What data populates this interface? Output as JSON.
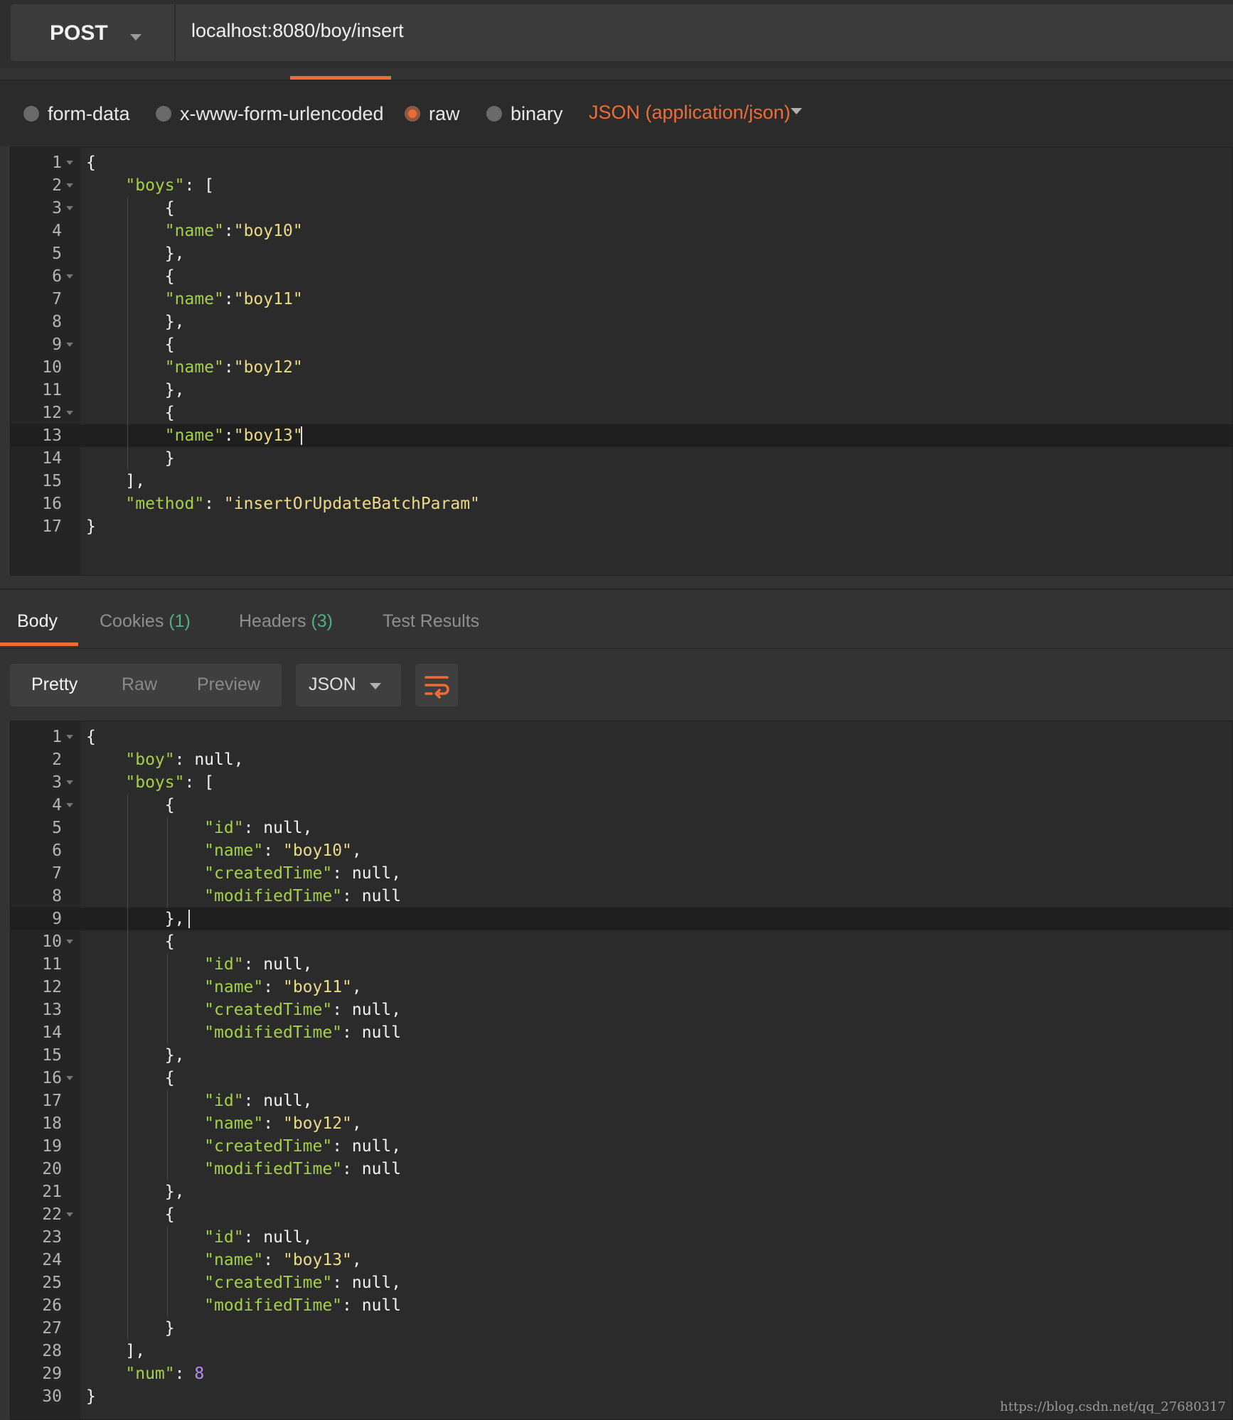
{
  "request": {
    "method": "POST",
    "url": "localhost:8080/boy/insert"
  },
  "body_type": {
    "options": [
      "form-data",
      "x-www-form-urlencoded",
      "raw",
      "binary"
    ],
    "selected": "raw",
    "content_type": "JSON (application/json)"
  },
  "request_body": {
    "lines": [
      {
        "n": "1",
        "fold": true,
        "tokens": [
          {
            "t": "p",
            "v": "{"
          }
        ]
      },
      {
        "n": "2",
        "fold": true,
        "tokens": [
          {
            "t": "p",
            "v": "    "
          },
          {
            "t": "k",
            "v": "\"boys\""
          },
          {
            "t": "p",
            "v": ": ["
          }
        ]
      },
      {
        "n": "3",
        "fold": true,
        "tokens": [
          {
            "t": "p",
            "v": "        {"
          }
        ]
      },
      {
        "n": "4",
        "fold": false,
        "tokens": [
          {
            "t": "p",
            "v": "        "
          },
          {
            "t": "k",
            "v": "\"name\""
          },
          {
            "t": "p",
            "v": ":"
          },
          {
            "t": "s",
            "v": "\"boy10\""
          }
        ]
      },
      {
        "n": "5",
        "fold": false,
        "tokens": [
          {
            "t": "p",
            "v": "        },"
          }
        ]
      },
      {
        "n": "6",
        "fold": true,
        "tokens": [
          {
            "t": "p",
            "v": "        {"
          }
        ]
      },
      {
        "n": "7",
        "fold": false,
        "tokens": [
          {
            "t": "p",
            "v": "        "
          },
          {
            "t": "k",
            "v": "\"name\""
          },
          {
            "t": "p",
            "v": ":"
          },
          {
            "t": "s",
            "v": "\"boy11\""
          }
        ]
      },
      {
        "n": "8",
        "fold": false,
        "tokens": [
          {
            "t": "p",
            "v": "        },"
          }
        ]
      },
      {
        "n": "9",
        "fold": true,
        "tokens": [
          {
            "t": "p",
            "v": "        {"
          }
        ]
      },
      {
        "n": "10",
        "fold": false,
        "tokens": [
          {
            "t": "p",
            "v": "        "
          },
          {
            "t": "k",
            "v": "\"name\""
          },
          {
            "t": "p",
            "v": ":"
          },
          {
            "t": "s",
            "v": "\"boy12\""
          }
        ]
      },
      {
        "n": "11",
        "fold": false,
        "tokens": [
          {
            "t": "p",
            "v": "        },"
          }
        ]
      },
      {
        "n": "12",
        "fold": true,
        "tokens": [
          {
            "t": "p",
            "v": "        {"
          }
        ]
      },
      {
        "n": "13",
        "fold": false,
        "tokens": [
          {
            "t": "p",
            "v": "        "
          },
          {
            "t": "k",
            "v": "\"name\""
          },
          {
            "t": "p",
            "v": ":"
          },
          {
            "t": "s",
            "v": "\"boy13\""
          }
        ]
      },
      {
        "n": "14",
        "fold": false,
        "tokens": [
          {
            "t": "p",
            "v": "        }"
          }
        ]
      },
      {
        "n": "15",
        "fold": false,
        "tokens": [
          {
            "t": "p",
            "v": "    ],"
          }
        ]
      },
      {
        "n": "16",
        "fold": false,
        "tokens": [
          {
            "t": "p",
            "v": "    "
          },
          {
            "t": "k",
            "v": "\"method\""
          },
          {
            "t": "p",
            "v": ": "
          },
          {
            "t": "s",
            "v": "\"insertOrUpdateBatchParam\""
          }
        ]
      },
      {
        "n": "17",
        "fold": false,
        "tokens": [
          {
            "t": "p",
            "v": "}"
          }
        ]
      }
    ]
  },
  "response_tabs": [
    {
      "label": "Body",
      "count": ""
    },
    {
      "label": "Cookies",
      "count": "(1)"
    },
    {
      "label": "Headers",
      "count": "(3)"
    },
    {
      "label": "Test Results",
      "count": ""
    }
  ],
  "view_modes": [
    "Pretty",
    "Raw",
    "Preview"
  ],
  "format": "JSON",
  "wrap_icon": "wrap-lines-icon",
  "accent_color": "#ef6c35",
  "response_body": {
    "lines": [
      {
        "n": "1",
        "fold": true,
        "tokens": [
          {
            "t": "p",
            "v": "{"
          }
        ]
      },
      {
        "n": "2",
        "fold": false,
        "tokens": [
          {
            "t": "p",
            "v": "    "
          },
          {
            "t": "k",
            "v": "\"boy\""
          },
          {
            "t": "p",
            "v": ": null,"
          }
        ]
      },
      {
        "n": "3",
        "fold": true,
        "tokens": [
          {
            "t": "p",
            "v": "    "
          },
          {
            "t": "k",
            "v": "\"boys\""
          },
          {
            "t": "p",
            "v": ": ["
          }
        ]
      },
      {
        "n": "4",
        "fold": true,
        "tokens": [
          {
            "t": "p",
            "v": "        {"
          }
        ]
      },
      {
        "n": "5",
        "fold": false,
        "tokens": [
          {
            "t": "p",
            "v": "            "
          },
          {
            "t": "k",
            "v": "\"id\""
          },
          {
            "t": "p",
            "v": ": null,"
          }
        ]
      },
      {
        "n": "6",
        "fold": false,
        "tokens": [
          {
            "t": "p",
            "v": "            "
          },
          {
            "t": "k",
            "v": "\"name\""
          },
          {
            "t": "p",
            "v": ": "
          },
          {
            "t": "s",
            "v": "\"boy10\""
          },
          {
            "t": "p",
            "v": ","
          }
        ]
      },
      {
        "n": "7",
        "fold": false,
        "tokens": [
          {
            "t": "p",
            "v": "            "
          },
          {
            "t": "k",
            "v": "\"createdTime\""
          },
          {
            "t": "p",
            "v": ": null,"
          }
        ]
      },
      {
        "n": "8",
        "fold": false,
        "tokens": [
          {
            "t": "p",
            "v": "            "
          },
          {
            "t": "k",
            "v": "\"modifiedTime\""
          },
          {
            "t": "p",
            "v": ": null"
          }
        ]
      },
      {
        "n": "9",
        "fold": false,
        "tokens": [
          {
            "t": "p",
            "v": "        },"
          }
        ]
      },
      {
        "n": "10",
        "fold": true,
        "tokens": [
          {
            "t": "p",
            "v": "        {"
          }
        ]
      },
      {
        "n": "11",
        "fold": false,
        "tokens": [
          {
            "t": "p",
            "v": "            "
          },
          {
            "t": "k",
            "v": "\"id\""
          },
          {
            "t": "p",
            "v": ": null,"
          }
        ]
      },
      {
        "n": "12",
        "fold": false,
        "tokens": [
          {
            "t": "p",
            "v": "            "
          },
          {
            "t": "k",
            "v": "\"name\""
          },
          {
            "t": "p",
            "v": ": "
          },
          {
            "t": "s",
            "v": "\"boy11\""
          },
          {
            "t": "p",
            "v": ","
          }
        ]
      },
      {
        "n": "13",
        "fold": false,
        "tokens": [
          {
            "t": "p",
            "v": "            "
          },
          {
            "t": "k",
            "v": "\"createdTime\""
          },
          {
            "t": "p",
            "v": ": null,"
          }
        ]
      },
      {
        "n": "14",
        "fold": false,
        "tokens": [
          {
            "t": "p",
            "v": "            "
          },
          {
            "t": "k",
            "v": "\"modifiedTime\""
          },
          {
            "t": "p",
            "v": ": null"
          }
        ]
      },
      {
        "n": "15",
        "fold": false,
        "tokens": [
          {
            "t": "p",
            "v": "        },"
          }
        ]
      },
      {
        "n": "16",
        "fold": true,
        "tokens": [
          {
            "t": "p",
            "v": "        {"
          }
        ]
      },
      {
        "n": "17",
        "fold": false,
        "tokens": [
          {
            "t": "p",
            "v": "            "
          },
          {
            "t": "k",
            "v": "\"id\""
          },
          {
            "t": "p",
            "v": ": null,"
          }
        ]
      },
      {
        "n": "18",
        "fold": false,
        "tokens": [
          {
            "t": "p",
            "v": "            "
          },
          {
            "t": "k",
            "v": "\"name\""
          },
          {
            "t": "p",
            "v": ": "
          },
          {
            "t": "s",
            "v": "\"boy12\""
          },
          {
            "t": "p",
            "v": ","
          }
        ]
      },
      {
        "n": "19",
        "fold": false,
        "tokens": [
          {
            "t": "p",
            "v": "            "
          },
          {
            "t": "k",
            "v": "\"createdTime\""
          },
          {
            "t": "p",
            "v": ": null,"
          }
        ]
      },
      {
        "n": "20",
        "fold": false,
        "tokens": [
          {
            "t": "p",
            "v": "            "
          },
          {
            "t": "k",
            "v": "\"modifiedTime\""
          },
          {
            "t": "p",
            "v": ": null"
          }
        ]
      },
      {
        "n": "21",
        "fold": false,
        "tokens": [
          {
            "t": "p",
            "v": "        },"
          }
        ]
      },
      {
        "n": "22",
        "fold": true,
        "tokens": [
          {
            "t": "p",
            "v": "        {"
          }
        ]
      },
      {
        "n": "23",
        "fold": false,
        "tokens": [
          {
            "t": "p",
            "v": "            "
          },
          {
            "t": "k",
            "v": "\"id\""
          },
          {
            "t": "p",
            "v": ": null,"
          }
        ]
      },
      {
        "n": "24",
        "fold": false,
        "tokens": [
          {
            "t": "p",
            "v": "            "
          },
          {
            "t": "k",
            "v": "\"name\""
          },
          {
            "t": "p",
            "v": ": "
          },
          {
            "t": "s",
            "v": "\"boy13\""
          },
          {
            "t": "p",
            "v": ","
          }
        ]
      },
      {
        "n": "25",
        "fold": false,
        "tokens": [
          {
            "t": "p",
            "v": "            "
          },
          {
            "t": "k",
            "v": "\"createdTime\""
          },
          {
            "t": "p",
            "v": ": null,"
          }
        ]
      },
      {
        "n": "26",
        "fold": false,
        "tokens": [
          {
            "t": "p",
            "v": "            "
          },
          {
            "t": "k",
            "v": "\"modifiedTime\""
          },
          {
            "t": "p",
            "v": ": null"
          }
        ]
      },
      {
        "n": "27",
        "fold": false,
        "tokens": [
          {
            "t": "p",
            "v": "        }"
          }
        ]
      },
      {
        "n": "28",
        "fold": false,
        "tokens": [
          {
            "t": "p",
            "v": "    ],"
          }
        ]
      },
      {
        "n": "29",
        "fold": false,
        "tokens": [
          {
            "t": "p",
            "v": "    "
          },
          {
            "t": "k",
            "v": "\"num\""
          },
          {
            "t": "p",
            "v": ": "
          },
          {
            "t": "num",
            "v": "8"
          }
        ]
      },
      {
        "n": "30",
        "fold": false,
        "tokens": [
          {
            "t": "p",
            "v": "}"
          }
        ]
      }
    ]
  },
  "watermark": "https://blog.csdn.net/qq_27680317"
}
